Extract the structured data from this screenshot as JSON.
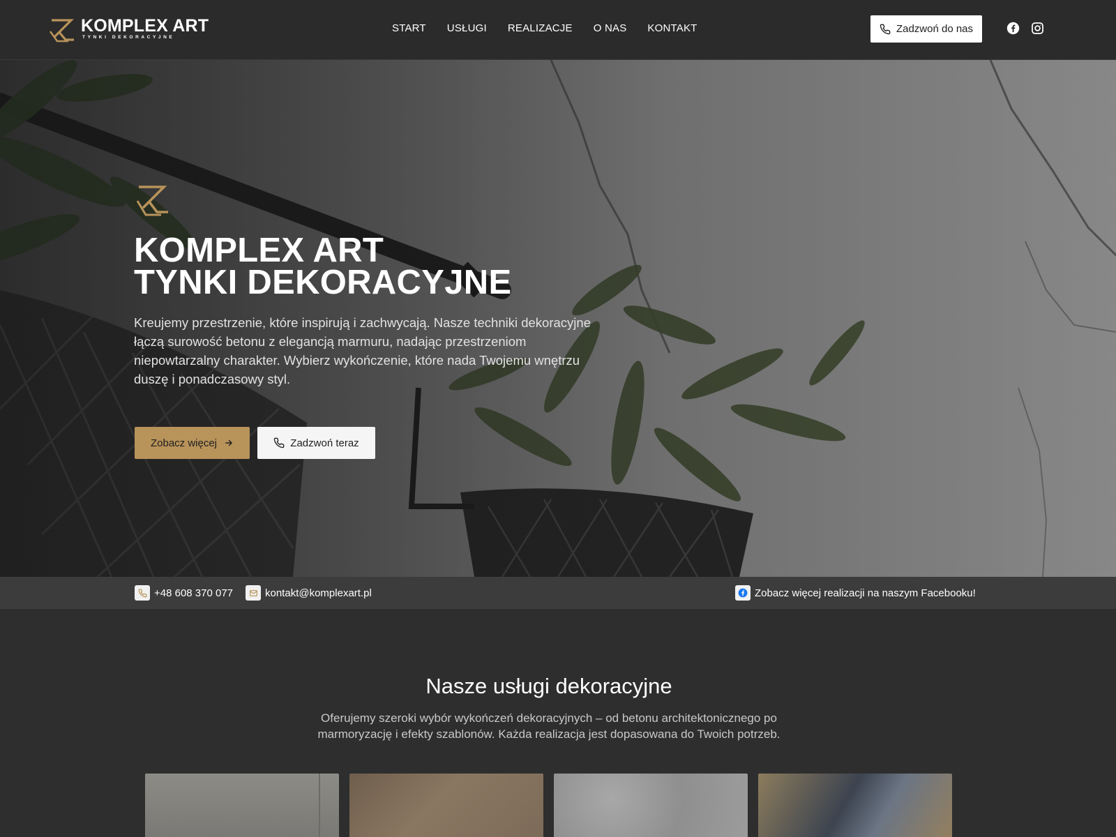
{
  "brand": {
    "name": "KOMPLEX ART",
    "tagline": "TYNKI DEKORACYJNE",
    "accent_color": "#b8935a"
  },
  "nav": {
    "items": [
      {
        "label": "START"
      },
      {
        "label": "USŁUGI"
      },
      {
        "label": "REALIZACJE"
      },
      {
        "label": "O NAS"
      },
      {
        "label": "KONTAKT"
      }
    ],
    "call_button": "Zadzwoń do nas",
    "social_icons": [
      "facebook-icon",
      "instagram-icon"
    ]
  },
  "hero": {
    "title_line1": "KOMPLEX ART",
    "title_line2": "TYNKI DEKORACYJNE",
    "description": "Kreujemy przestrzenie, które inspirują i zachwycają. Nasze techniki dekoracyjne łączą surowość betonu z elegancją marmuru, nadając przestrzeniom niepowtarzalny charakter. Wybierz wykończenie, które nada Twojemu wnętrzu duszę i ponadczasowy styl.",
    "primary_button": "Zobacz więcej",
    "secondary_button": "Zadzwoń teraz"
  },
  "contact_bar": {
    "phone": "+48 608 370 077",
    "email": "kontakt@komplexart.pl",
    "facebook_text": "Zobacz więcej realizacji na naszym Facebooku!"
  },
  "services": {
    "title": "Nasze usługi dekoracyjne",
    "description": "Oferujemy szeroki wybór wykończeń dekoracyjnych – od betonu architektonicznego po marmoryzację i efekty szablonów. Każda realizacja jest dopasowana do Twoich potrzeb."
  }
}
